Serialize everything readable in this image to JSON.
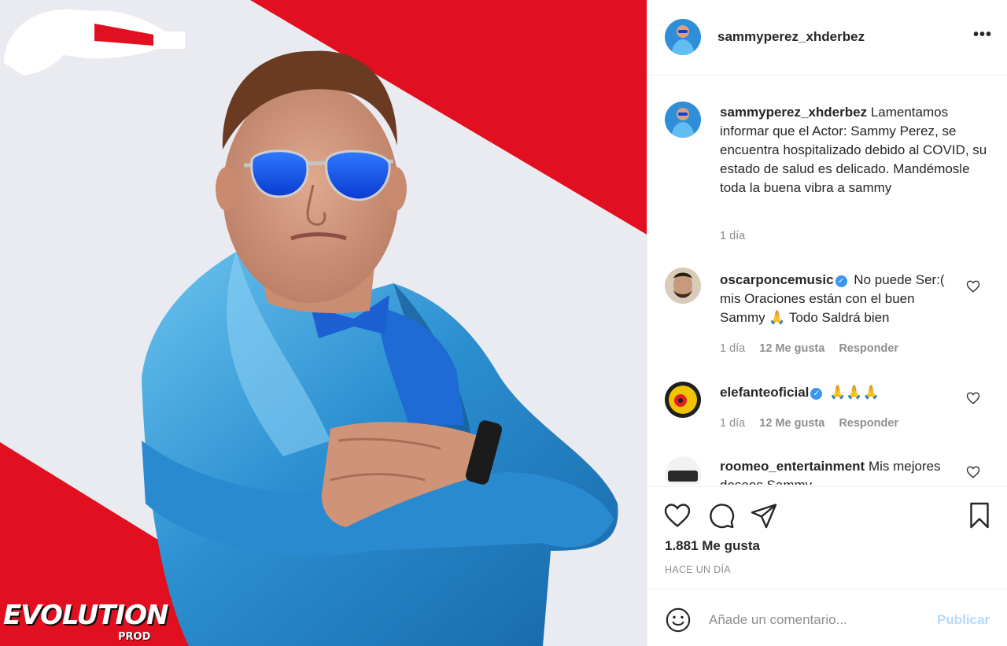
{
  "post": {
    "username": "sammyperez_xhderbez",
    "more_label": "•••",
    "image_alt": "Sammy Perez in blue satin suit and blue sunglasses",
    "logo_text": "VOLUTION",
    "logo_letter": "E",
    "logo_sub": "PROD"
  },
  "caption": {
    "username": "sammyperez_xhderbez",
    "text": "Lamentamos informar que el Actor: Sammy Perez, se encuentra hospitalizado debido al COVID, su estado de salud es delicado. Mandémosle toda la buena vibra a sammy",
    "time": "1 día"
  },
  "comments": [
    {
      "username": "oscarponcemusic",
      "verified": true,
      "text": "No puede Ser:( mis Oraciones están con el buen Sammy 🙏 Todo Saldrá bien",
      "time": "1 día",
      "likes": "12 Me gusta",
      "reply": "Responder"
    },
    {
      "username": "elefanteoficial",
      "verified": true,
      "text": "🙏🙏🙏",
      "time": "1 día",
      "likes": "12 Me gusta",
      "reply": "Responder"
    },
    {
      "username": "roomeo_entertainment",
      "verified": false,
      "text": "Mis mejores deseos Sammy",
      "time": "",
      "likes": "",
      "reply": ""
    }
  ],
  "actions": {
    "like_icon": "heart-icon",
    "comment_icon": "comment-icon",
    "share_icon": "send-icon",
    "save_icon": "bookmark-icon",
    "likes_count": "1.881 Me gusta",
    "posted": "HACE UN DÍA"
  },
  "add_comment": {
    "placeholder": "Añade un comentario...",
    "post_label": "Publicar",
    "emoji_icon": "smile-icon"
  },
  "colors": {
    "red": "#e10f1f",
    "accent_blue": "#3897f0",
    "post_disabled": "#b3dbff"
  }
}
